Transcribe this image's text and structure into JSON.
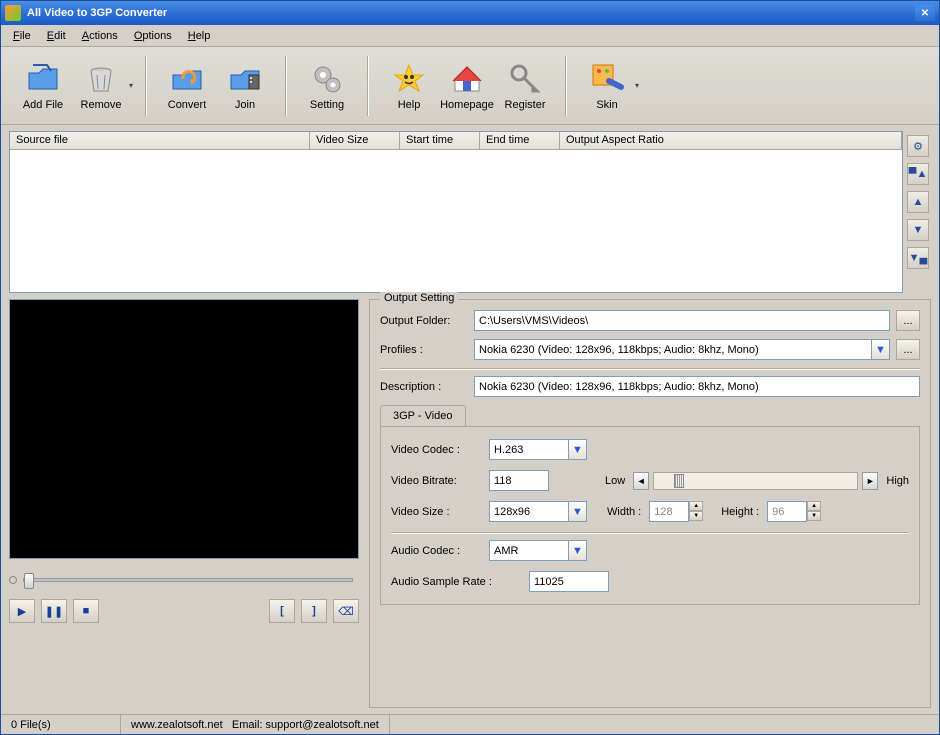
{
  "window": {
    "title": "All Video to 3GP Converter"
  },
  "menu": {
    "file": "File",
    "edit": "Edit",
    "actions": "Actions",
    "options": "Options",
    "help": "Help"
  },
  "toolbar": {
    "addfile": "Add File",
    "remove": "Remove",
    "convert": "Convert",
    "join": "Join",
    "setting": "Setting",
    "help": "Help",
    "homepage": "Homepage",
    "register": "Register",
    "skin": "Skin"
  },
  "columns": {
    "source": "Source file",
    "vsize": "Video Size",
    "start": "Start time",
    "end": "End time",
    "aspect": "Output Aspect Ratio"
  },
  "output": {
    "legend": "Output Setting",
    "folder_label": "Output Folder:",
    "folder_value": "C:\\Users\\VMS\\Videos\\",
    "profiles_label": "Profiles :",
    "profiles_value": "Nokia 6230 (Video: 128x96, 118kbps; Audio: 8khz, Mono)",
    "desc_label": "Description :",
    "desc_value": "Nokia 6230 (Video: 128x96, 118kbps; Audio: 8khz, Mono)",
    "browse": "..."
  },
  "tab": {
    "name": "3GP - Video",
    "vcodec_label": "Video Codec :",
    "vcodec_value": "H.263",
    "vbitrate_label": "Video Bitrate:",
    "vbitrate_value": "118",
    "low": "Low",
    "high": "High",
    "vsize_label": "Video Size :",
    "vsize_value": "128x96",
    "width_label": "Width :",
    "width_value": "128",
    "height_label": "Height :",
    "height_value": "96",
    "acodec_label": "Audio Codec :",
    "acodec_value": "AMR",
    "asample_label": "Audio Sample Rate :",
    "asample_value": "11025"
  },
  "status": {
    "files": "0 File(s)",
    "url": "www.zealotsoft.net",
    "email": "Email: support@zealotsoft.net"
  }
}
